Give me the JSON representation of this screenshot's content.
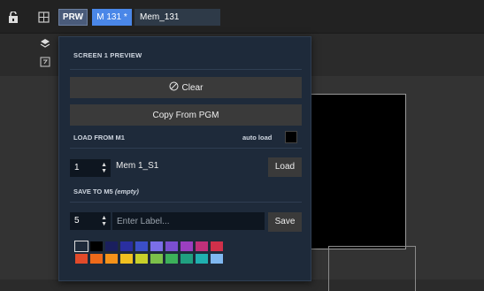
{
  "topbar": {
    "prw_label": "PRW",
    "mem_label": "M 131 *",
    "mem_name": "Mem_131"
  },
  "panel": {
    "title": "SCREEN 1 PREVIEW",
    "clear_label": "Clear",
    "copy_label": "Copy From PGM",
    "load_section": "LOAD FROM M1",
    "autoload_label": "auto load",
    "autoload_checked": false,
    "load_number": "1",
    "load_mem_name": "Mem 1_S1",
    "load_button": "Load",
    "save_section_prefix": "SAVE TO M5",
    "save_section_suffix": "(empty)",
    "save_number": "5",
    "label_placeholder": "Enter Label...",
    "label_value": "",
    "save_button": "Save"
  },
  "swatches": {
    "row1": [
      "#1e2a3a",
      "#000000",
      "#1a1f5e",
      "#2a2fa0",
      "#3b4fc8",
      "#7b6fe8",
      "#7a4fd0",
      "#9b3fc0",
      "#c0307a",
      "#d0304a"
    ],
    "row2": [
      "#e24a2a",
      "#ee6a1a",
      "#f5921a",
      "#f0c020",
      "#c8d02a",
      "#7cc04a",
      "#3cb05a",
      "#20a080",
      "#20b0b0",
      "#80b8f0"
    ],
    "selected_index": 0
  },
  "icons": {
    "lock": "lock-icon",
    "layout": "layout-icon",
    "stack": "stack-icon",
    "tv": "tv-icon",
    "clear": "circle-slash-icon"
  }
}
